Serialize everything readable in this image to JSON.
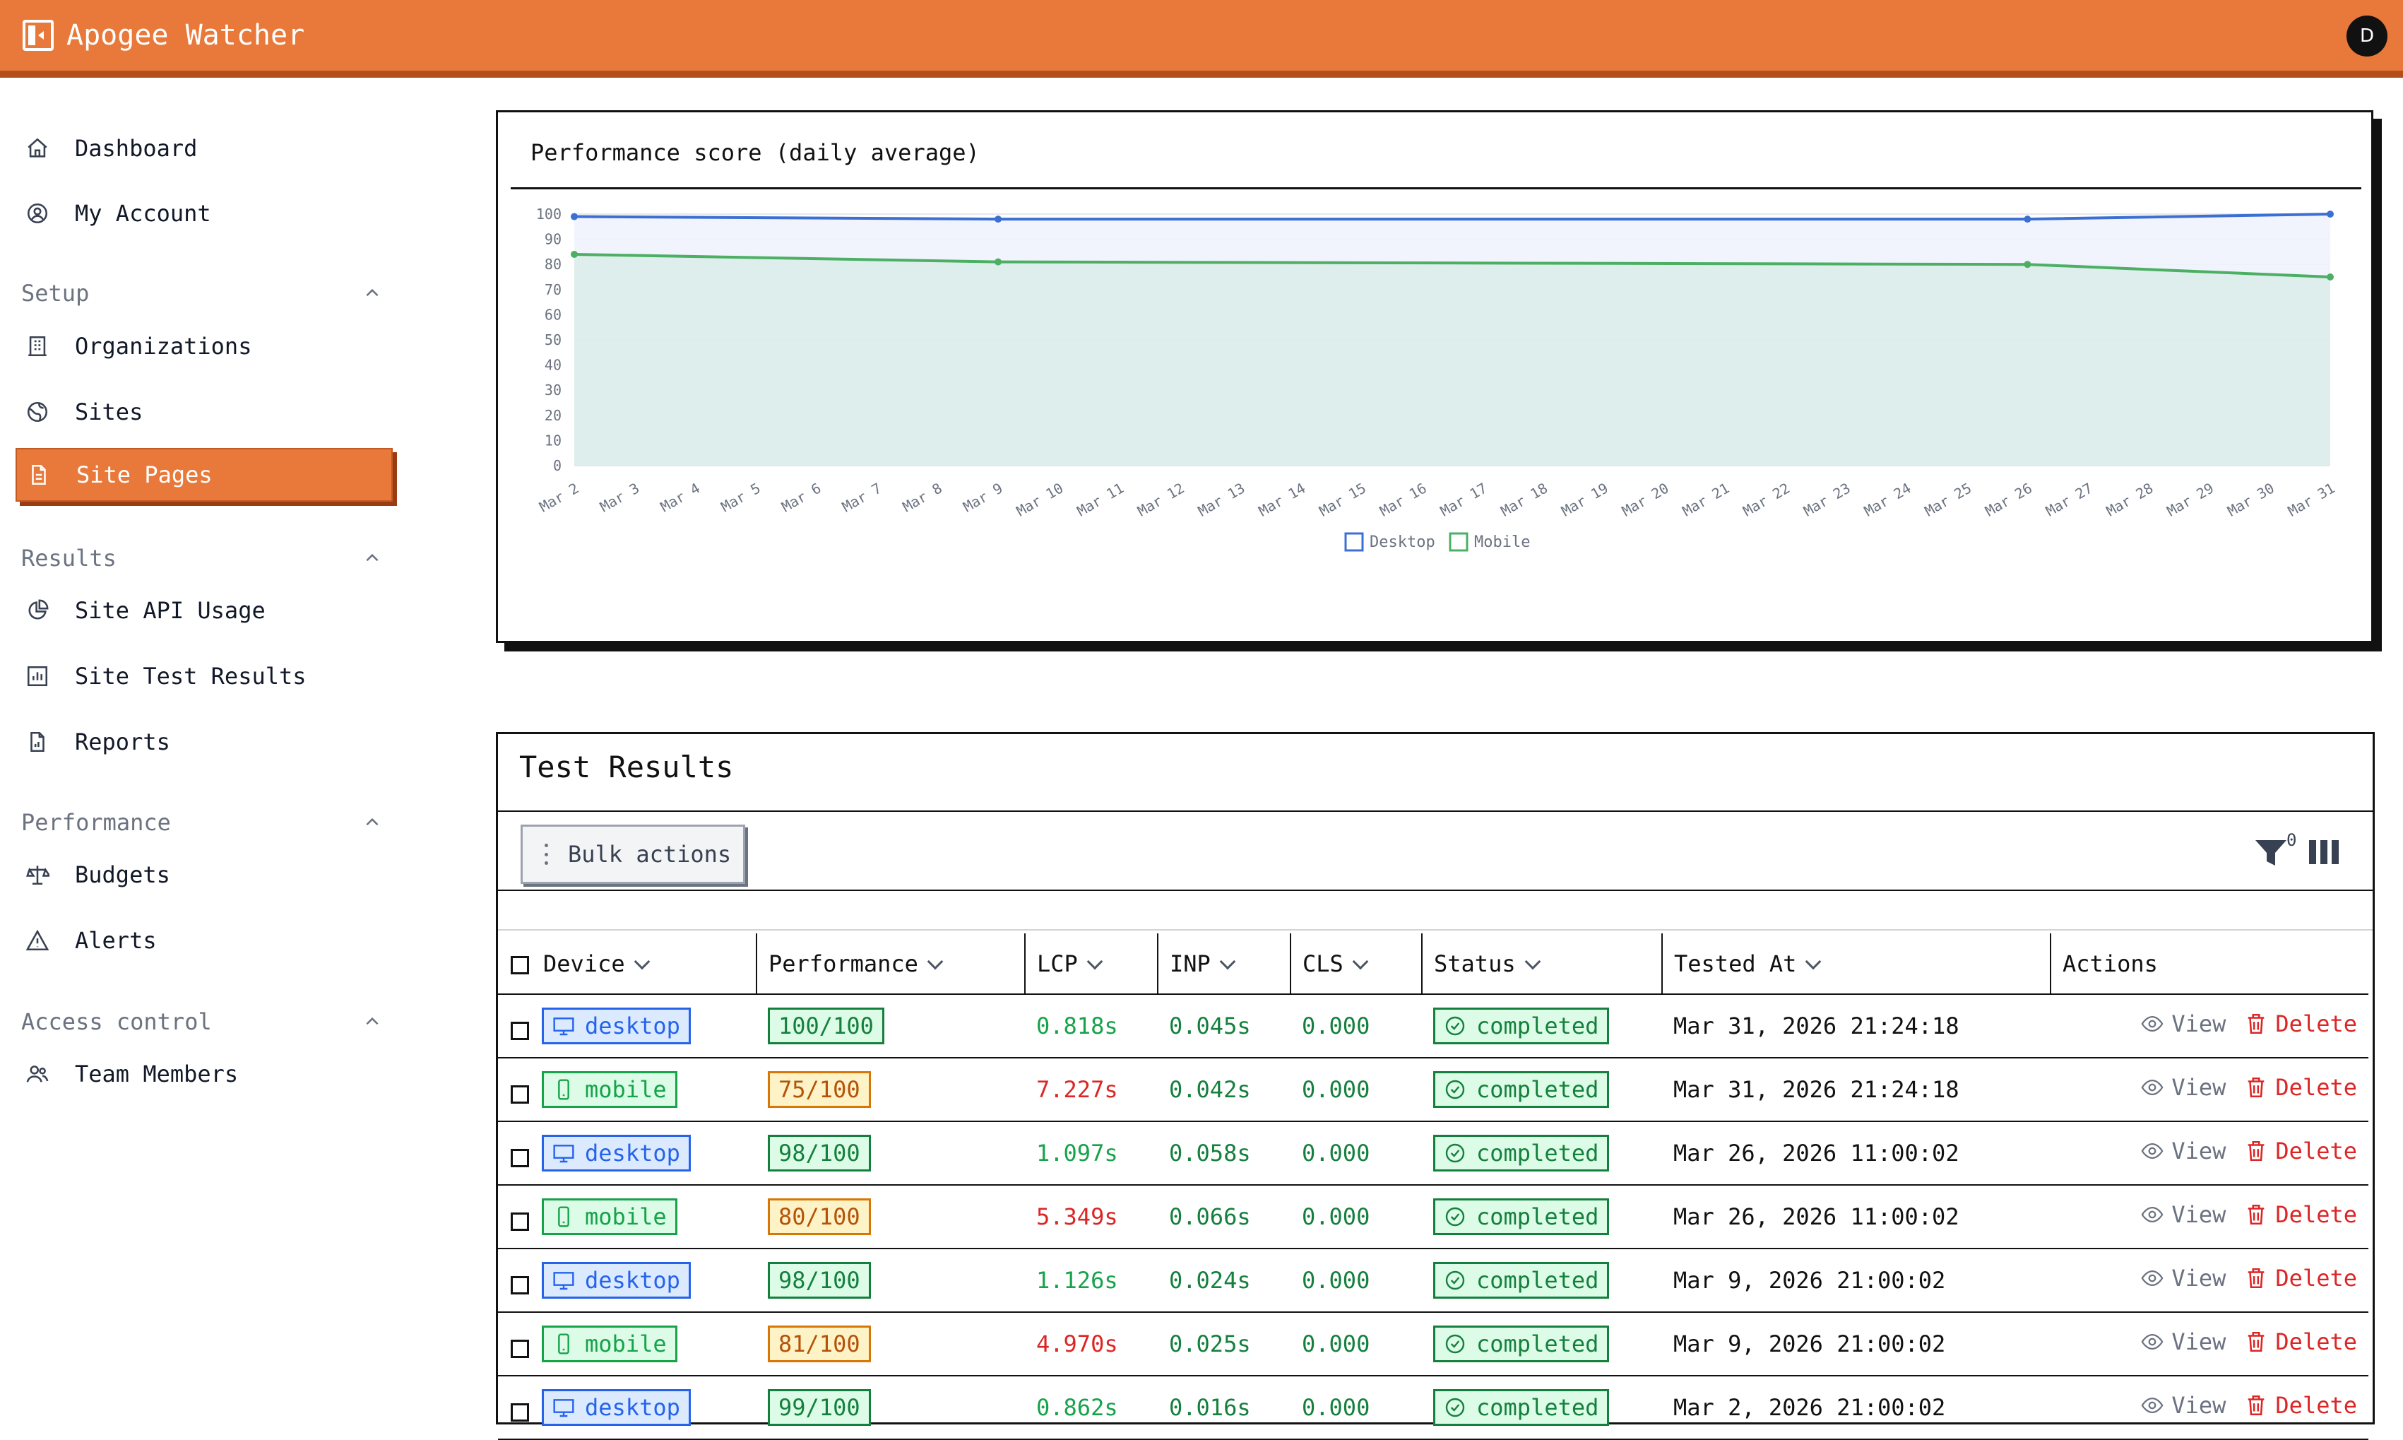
{
  "app": {
    "title": "Apogee Watcher",
    "avatar": "D"
  },
  "sidebar": {
    "top": [
      {
        "label": "Dashboard",
        "icon": "home-icon"
      },
      {
        "label": "My Account",
        "icon": "user-circle-icon"
      }
    ],
    "sections": [
      {
        "title": "Setup",
        "items": [
          {
            "label": "Organizations",
            "icon": "building-icon"
          },
          {
            "label": "Sites",
            "icon": "globe-icon"
          },
          {
            "label": "Site Pages",
            "icon": "document-icon",
            "active": true
          }
        ]
      },
      {
        "title": "Results",
        "items": [
          {
            "label": "Site API Usage",
            "icon": "pie-chart-icon"
          },
          {
            "label": "Site Test Results",
            "icon": "bar-chart-icon"
          },
          {
            "label": "Reports",
            "icon": "report-icon"
          }
        ]
      },
      {
        "title": "Performance",
        "items": [
          {
            "label": "Budgets",
            "icon": "scale-icon"
          },
          {
            "label": "Alerts",
            "icon": "alert-triangle-icon"
          }
        ]
      },
      {
        "title": "Access control",
        "items": [
          {
            "label": "Team Members",
            "icon": "users-icon"
          }
        ]
      }
    ]
  },
  "chart_data": {
    "type": "area",
    "title": "Performance score (daily average)",
    "categories": [
      "Mar 2",
      "Mar 3",
      "Mar 4",
      "Mar 5",
      "Mar 6",
      "Mar 7",
      "Mar 8",
      "Mar 9",
      "Mar 10",
      "Mar 11",
      "Mar 12",
      "Mar 13",
      "Mar 14",
      "Mar 15",
      "Mar 16",
      "Mar 17",
      "Mar 18",
      "Mar 19",
      "Mar 20",
      "Mar 21",
      "Mar 22",
      "Mar 23",
      "Mar 24",
      "Mar 25",
      "Mar 26",
      "Mar 27",
      "Mar 28",
      "Mar 29",
      "Mar 30",
      "Mar 31"
    ],
    "ylim": [
      0,
      100
    ],
    "yticks": [
      0,
      10,
      20,
      30,
      40,
      50,
      60,
      70,
      80,
      90,
      100
    ],
    "legend_position": "bottom",
    "series": [
      {
        "name": "Desktop",
        "color": "#3b6fd4",
        "fill": "#eef2fc",
        "points": [
          {
            "x": "Mar 2",
            "y": 99
          },
          {
            "x": "Mar 9",
            "y": 98
          },
          {
            "x": "Mar 26",
            "y": 98
          },
          {
            "x": "Mar 31",
            "y": 100
          }
        ]
      },
      {
        "name": "Mobile",
        "color": "#4caf64",
        "fill": "#d9ece9",
        "points": [
          {
            "x": "Mar 2",
            "y": 84
          },
          {
            "x": "Mar 9",
            "y": 81
          },
          {
            "x": "Mar 26",
            "y": 80
          },
          {
            "x": "Mar 31",
            "y": 75
          }
        ]
      }
    ]
  },
  "results": {
    "title": "Test Results",
    "bulk_label": "Bulk actions",
    "filter_count": "0",
    "columns": [
      "Device",
      "Performance",
      "LCP",
      "INP",
      "CLS",
      "Status",
      "Tested At",
      "Actions"
    ],
    "view_label": "View",
    "delete_label": "Delete",
    "rows": [
      {
        "device": "desktop",
        "performance": "100/100",
        "perf_level": "good",
        "lcp": "0.818s",
        "lcp_level": "good",
        "inp": "0.045s",
        "cls": "0.000",
        "status": "completed",
        "tested_at": "Mar 31, 2026 21:24:18"
      },
      {
        "device": "mobile",
        "performance": "75/100",
        "perf_level": "mid",
        "lcp": "7.227s",
        "lcp_level": "bad",
        "inp": "0.042s",
        "cls": "0.000",
        "status": "completed",
        "tested_at": "Mar 31, 2026 21:24:18"
      },
      {
        "device": "desktop",
        "performance": "98/100",
        "perf_level": "good",
        "lcp": "1.097s",
        "lcp_level": "good",
        "inp": "0.058s",
        "cls": "0.000",
        "status": "completed",
        "tested_at": "Mar 26, 2026 11:00:02"
      },
      {
        "device": "mobile",
        "performance": "80/100",
        "perf_level": "mid",
        "lcp": "5.349s",
        "lcp_level": "bad",
        "inp": "0.066s",
        "cls": "0.000",
        "status": "completed",
        "tested_at": "Mar 26, 2026 11:00:02"
      },
      {
        "device": "desktop",
        "performance": "98/100",
        "perf_level": "good",
        "lcp": "1.126s",
        "lcp_level": "good",
        "inp": "0.024s",
        "cls": "0.000",
        "status": "completed",
        "tested_at": "Mar 9, 2026 21:00:02"
      },
      {
        "device": "mobile",
        "performance": "81/100",
        "perf_level": "mid",
        "lcp": "4.970s",
        "lcp_level": "bad",
        "inp": "0.025s",
        "cls": "0.000",
        "status": "completed",
        "tested_at": "Mar 9, 2026 21:00:02"
      },
      {
        "device": "desktop",
        "performance": "99/100",
        "perf_level": "good",
        "lcp": "0.862s",
        "lcp_level": "good",
        "inp": "0.016s",
        "cls": "0.000",
        "status": "completed",
        "tested_at": "Mar 2, 2026 21:00:02"
      }
    ]
  }
}
